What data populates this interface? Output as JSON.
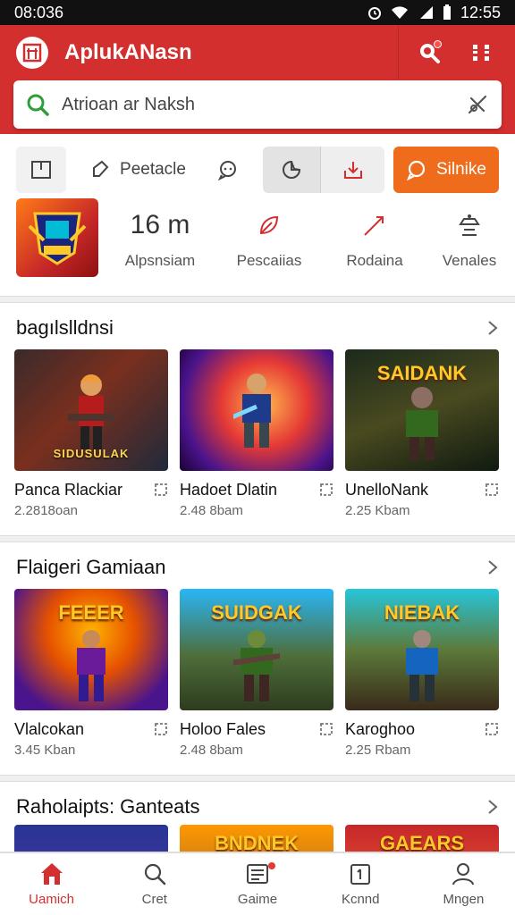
{
  "status": {
    "time_left": "08:036",
    "time_right": "12:55"
  },
  "header": {
    "title": "AplukANasn",
    "search_text": "Atrioan ar Naksh"
  },
  "toolbar": {
    "peetacle_label": "Peetacle",
    "subscribe_label": "Silnike"
  },
  "stats": {
    "rating_value": "16 m",
    "items": [
      {
        "label": "Alpsnsiam"
      },
      {
        "label": "Pescaiias"
      },
      {
        "label": "Rodaina"
      },
      {
        "label": "Venales"
      }
    ]
  },
  "sections": [
    {
      "title": "bagılslldnsi",
      "games": [
        {
          "title": "Panca Rlackiar",
          "size": "2.2818oan",
          "caption": "SIDUSULAK"
        },
        {
          "title": "Hadoet Dlatin",
          "size": "2.48 8bam",
          "caption": ""
        },
        {
          "title": "UnelloNank",
          "size": "2.25 Kbam",
          "caption": "SAIDANK"
        }
      ]
    },
    {
      "title": "Flaigeri Gamiaan",
      "games": [
        {
          "title": "Vlalcokan",
          "size": "3.45 Kban",
          "caption": "FEEER"
        },
        {
          "title": "Holoo Fales",
          "size": "2.48 8bam",
          "caption": "SUIDGAK"
        },
        {
          "title": "Karoghoo",
          "size": "2.25 Rbam",
          "caption": "NIEBAK"
        }
      ]
    },
    {
      "title": "Raholaipts: Ganteats",
      "games": [
        {
          "title": "",
          "size": "",
          "caption": ""
        },
        {
          "title": "",
          "size": "",
          "caption": "BNDNEK"
        },
        {
          "title": "",
          "size": "",
          "caption": "GAEARS"
        }
      ]
    }
  ],
  "nav": [
    {
      "label": "Uamich",
      "icon": "home-icon"
    },
    {
      "label": "Cret",
      "icon": "search-icon"
    },
    {
      "label": "Gaime",
      "icon": "list-icon"
    },
    {
      "label": "Kcnnd",
      "icon": "box-icon"
    },
    {
      "label": "Mngen",
      "icon": "user-icon"
    }
  ],
  "colors": {
    "primary": "#d32f2f",
    "accent": "#ef6c1c"
  }
}
